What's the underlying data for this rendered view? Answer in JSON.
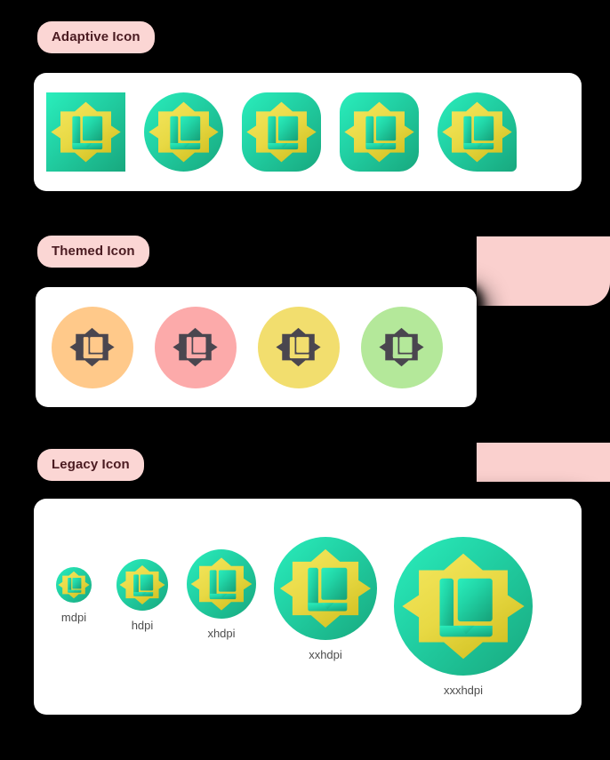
{
  "page": {
    "background": "#000000",
    "accent_pink": "#FAD0CE",
    "label_bg": "#FBD6D4",
    "label_text_color": "#4A1B21",
    "card_bg": "#FFFFFF"
  },
  "icon": {
    "semantic": "book-rosette-app-icon",
    "foreground_gradient": [
      "#F2E455",
      "#D9C92A"
    ],
    "background_gradient": [
      "#2AEEBC",
      "#18A87E"
    ]
  },
  "sections": [
    {
      "id": "adaptive",
      "label": "Adaptive Icon",
      "icons": [
        {
          "shape": "square",
          "name": "adaptive-icon-square"
        },
        {
          "shape": "circle",
          "name": "adaptive-icon-circle"
        },
        {
          "shape": "squircle",
          "name": "adaptive-icon-squircle"
        },
        {
          "shape": "rounded",
          "name": "adaptive-icon-rounded-square"
        },
        {
          "shape": "teardrop",
          "name": "adaptive-icon-teardrop"
        }
      ]
    },
    {
      "id": "themed",
      "label": "Themed Icon",
      "icons": [
        {
          "bg": "#FFC98A",
          "fg": "#4A464F",
          "name": "themed-icon-orange"
        },
        {
          "bg": "#FCAAAA",
          "fg": "#4A464F",
          "name": "themed-icon-pink"
        },
        {
          "bg": "#F2DE6E",
          "fg": "#4A464F",
          "name": "themed-icon-yellow"
        },
        {
          "bg": "#B4E89A",
          "fg": "#4A464F",
          "name": "themed-icon-green"
        }
      ]
    },
    {
      "id": "legacy",
      "label": "Legacy Icon",
      "icons": [
        {
          "label": "mdpi",
          "size": 40,
          "name": "legacy-icon-mdpi"
        },
        {
          "label": "hdpi",
          "size": 58,
          "name": "legacy-icon-hdpi"
        },
        {
          "label": "xhdpi",
          "size": 78,
          "name": "legacy-icon-xhdpi"
        },
        {
          "label": "xxhdpi",
          "size": 116,
          "name": "legacy-icon-xxhdpi"
        },
        {
          "label": "xxxhdpi",
          "size": 156,
          "name": "legacy-icon-xxxhdpi"
        }
      ]
    }
  ]
}
